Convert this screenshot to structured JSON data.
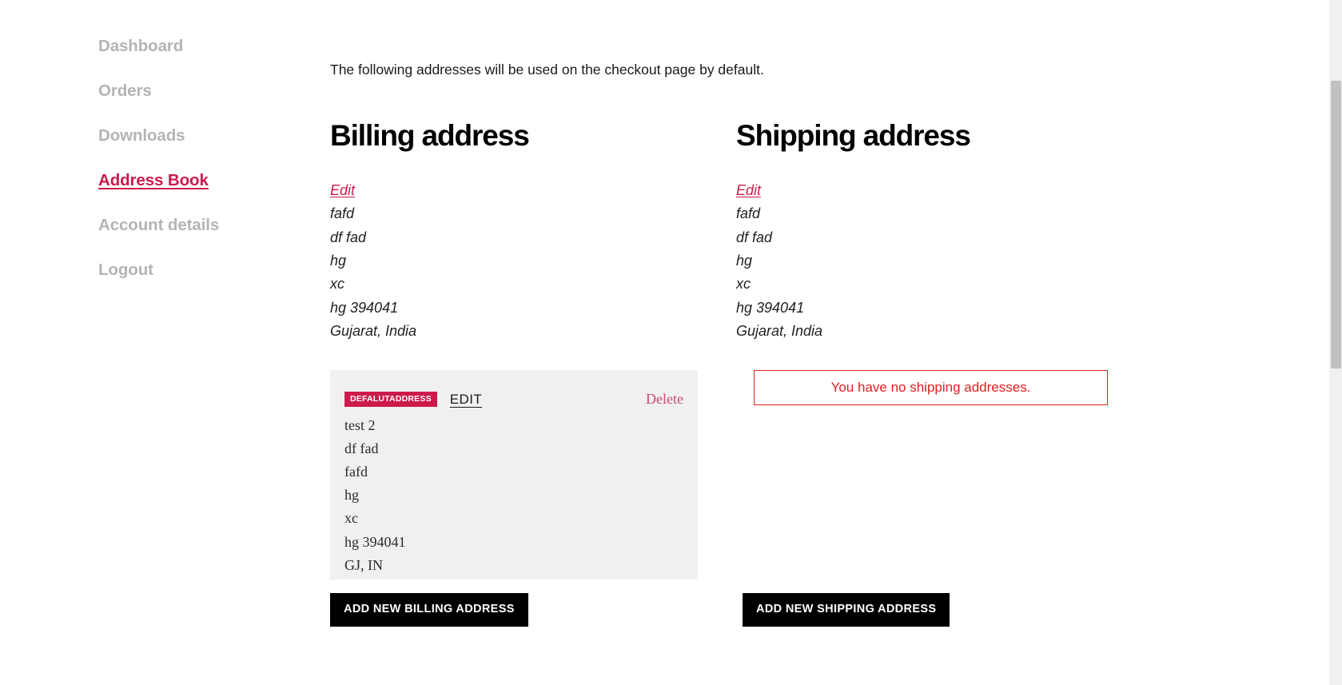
{
  "sidebar": {
    "items": [
      {
        "label": "Dashboard",
        "active": false
      },
      {
        "label": "Orders",
        "active": false
      },
      {
        "label": "Downloads",
        "active": false
      },
      {
        "label": "Address Book",
        "active": true
      },
      {
        "label": "Account details",
        "active": false
      },
      {
        "label": "Logout",
        "active": false
      }
    ]
  },
  "main": {
    "intro": "The following addresses will be used on the checkout page by default."
  },
  "billing": {
    "title": "Billing address",
    "edit_label": "Edit",
    "address_lines": [
      "fafd",
      "df fad",
      "hg",
      "xc",
      "hg 394041",
      "Gujarat, India"
    ],
    "card": {
      "badge": "DEFALUTADDRESS",
      "edit_label": "EDIT",
      "delete_label": "Delete",
      "lines": [
        "test 2",
        "df fad",
        "fafd",
        "hg",
        "xc",
        "hg 394041",
        "GJ, IN"
      ]
    },
    "add_button": "ADD NEW BILLING ADDRESS"
  },
  "shipping": {
    "title": "Shipping address",
    "edit_label": "Edit",
    "address_lines": [
      "fafd",
      "df fad",
      "hg",
      "xc",
      "hg 394041",
      "Gujarat, India"
    ],
    "notice": "You have no shipping addresses.",
    "add_button": "ADD NEW SHIPPING ADDRESS"
  },
  "colors": {
    "accent": "#cc1a4b",
    "nav_inactive": "#b4b4b4",
    "notice_red": "#e02020",
    "card_bg": "#f0f0f0",
    "button_bg": "#000000"
  }
}
